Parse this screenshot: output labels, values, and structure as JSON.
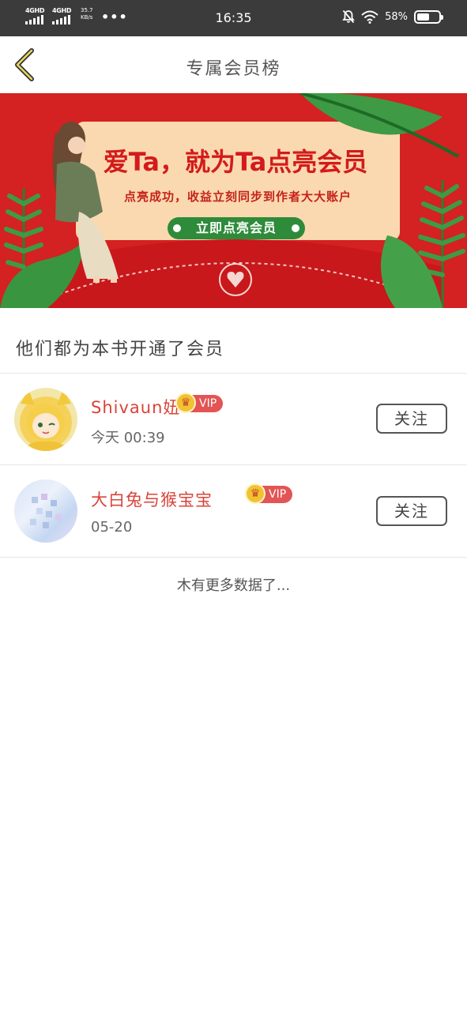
{
  "status_bar": {
    "sim1": "4GHD",
    "sim2": "4GHD",
    "net_speed": "35.7",
    "net_unit": "KB/s",
    "dots": "•••",
    "time": "16:35",
    "battery": "58%",
    "battery_level": 0.58
  },
  "header": {
    "title": "专属会员榜"
  },
  "banner": {
    "headline": "爱Ta，就为Ta点亮会员",
    "subline": "点亮成功，收益立刻同步到作者大大账户",
    "cta": "立即点亮会员",
    "colors": {
      "background": "#d42121",
      "card": "#fbd9b0",
      "button": "#2e8b3a"
    }
  },
  "section": {
    "title": "他们都为本书开通了会员"
  },
  "members": [
    {
      "name": "Shivaun妞",
      "badge": "VIP",
      "time": "今天 00:39",
      "follow": "关注"
    },
    {
      "name": "大白兔与猴宝宝",
      "badge": "VIP",
      "time": "05-20",
      "follow": "关注"
    }
  ],
  "footer": {
    "no_more": "木有更多数据了..."
  }
}
